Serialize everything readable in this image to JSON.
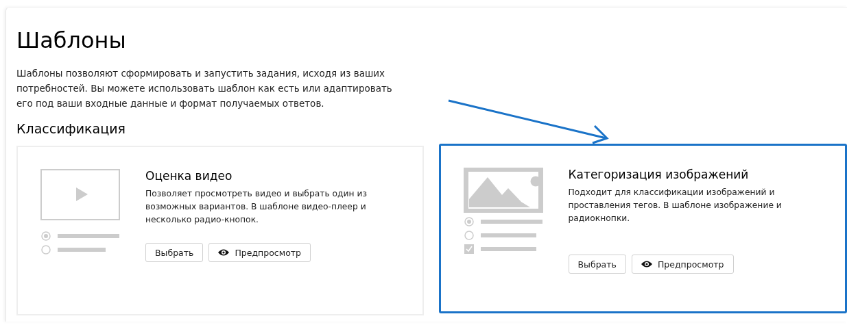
{
  "page": {
    "title": "Шаблоны",
    "description": "Шаблоны позволяют сформировать и запустить задания, исходя из ваших потребностей. Вы можете использовать шаблон как есть или адаптировать его под ваши входные данные и формат получаемых ответов."
  },
  "section": {
    "title": "Классификация"
  },
  "cards": [
    {
      "kind": "video",
      "highlighted": false,
      "title": "Оценка видео",
      "description": "Позволяет просмотреть видео и выбрать один из возможных вариантов. В шаблоне видео-плеер и несколько радио-кнопок.",
      "buttons": [
        {
          "kind": "select",
          "label": "Выбрать"
        },
        {
          "kind": "preview",
          "label": "Предпросмотр"
        }
      ]
    },
    {
      "kind": "image",
      "highlighted": true,
      "title": "Категоризация изображений",
      "description": "Подходит для классификации изображений и проставления тегов. В шаблоне изображение и радиокнопки.",
      "buttons": [
        {
          "kind": "select",
          "label": "Выбрать"
        },
        {
          "kind": "preview",
          "label": "Предпросмотр"
        }
      ]
    }
  ],
  "annotation": {
    "kind": "arrow"
  }
}
